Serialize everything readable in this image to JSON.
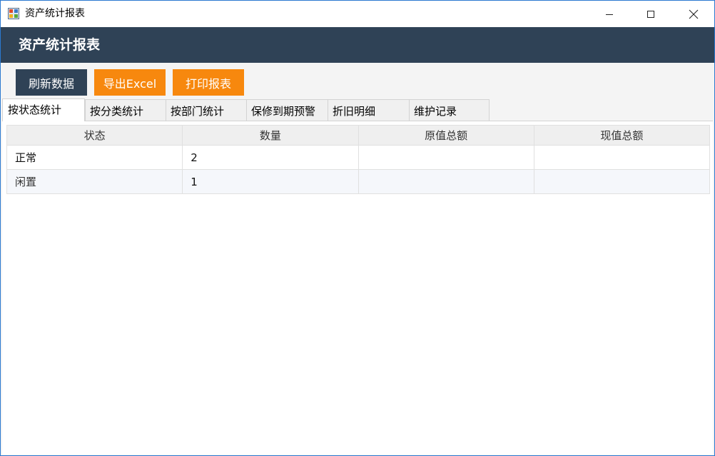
{
  "window": {
    "title": "资产统计报表",
    "icon": "app-window-icon",
    "controls": [
      "minimize-icon",
      "maximize-icon",
      "close-icon"
    ]
  },
  "header": {
    "title": "资产统计报表"
  },
  "toolbar": {
    "refresh_label": "刷新数据",
    "export_label": "导出Excel",
    "print_label": "打印报表"
  },
  "tabs": [
    {
      "label": "按状态统计",
      "active": true
    },
    {
      "label": "按分类统计",
      "active": false
    },
    {
      "label": "按部门统计",
      "active": false
    },
    {
      "label": "保修到期预警",
      "active": false
    },
    {
      "label": "折旧明细",
      "active": false
    },
    {
      "label": "维护记录",
      "active": false
    }
  ],
  "grid": {
    "columns": [
      "状态",
      "数量",
      "原值总额",
      "现值总额"
    ],
    "rows": [
      [
        "正常",
        "2",
        "",
        ""
      ],
      [
        "闲置",
        "1",
        "",
        ""
      ]
    ]
  },
  "colors": {
    "header_bg": "#2f4256",
    "accent_orange": "#f7880e",
    "window_border": "#2b79d0"
  }
}
